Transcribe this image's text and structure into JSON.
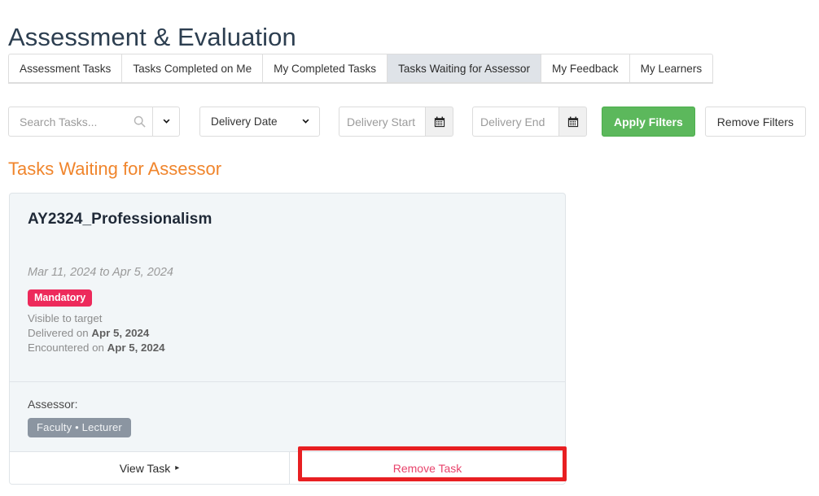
{
  "page": {
    "title": "Assessment & Evaluation"
  },
  "tabs": [
    {
      "label": "Assessment Tasks",
      "active": false
    },
    {
      "label": "Tasks Completed on Me",
      "active": false
    },
    {
      "label": "My Completed Tasks",
      "active": false
    },
    {
      "label": "Tasks Waiting for Assessor",
      "active": true
    },
    {
      "label": "My Feedback",
      "active": false
    },
    {
      "label": "My Learners",
      "active": false
    }
  ],
  "filters": {
    "search": {
      "value": "",
      "placeholder": "Search Tasks...",
      "icon": "search-icon",
      "dropdown_icon": "chevron-down-icon"
    },
    "sort_select": {
      "selected": "Delivery Date",
      "icon": "chevron-down-icon"
    },
    "delivery_start": {
      "value": "",
      "placeholder": "Delivery Start",
      "icon": "calendar-icon"
    },
    "delivery_end": {
      "value": "",
      "placeholder": "Delivery End",
      "icon": "calendar-icon"
    },
    "apply_label": "Apply Filters",
    "remove_label": "Remove Filters"
  },
  "section": {
    "heading": "Tasks Waiting for Assessor"
  },
  "task_card": {
    "title": "AY2324_Professionalism",
    "date_range": "Mar 11, 2024 to Apr 5, 2024",
    "badge": "Mandatory",
    "visibility": "Visible to target",
    "delivered_prefix": "Delivered on ",
    "delivered_date": "Apr 5, 2024",
    "encountered_prefix": "Encountered on ",
    "encountered_date": "Apr 5, 2024",
    "assessor_label": "Assessor:",
    "assessor_role": "Faculty • Lecturer",
    "view_label": "View Task",
    "view_arrow": "▸",
    "remove_label": "Remove Task"
  },
  "colors": {
    "page_title": "#2c3e50",
    "section_heading": "#f0852c",
    "apply_button": "#5cb85c",
    "mandatory_badge": "#ed2a5b",
    "role_badge": "#8b95a1",
    "remove_task_text": "#e8436b",
    "annotation_border": "#e81f22",
    "active_tab_bg": "#dfe3e8",
    "card_bg": "#f2f6f8"
  }
}
